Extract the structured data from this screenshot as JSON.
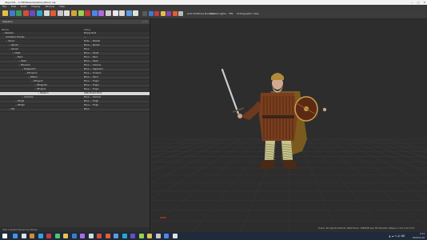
{
  "window": {
    "title": "Object32 - C:\\HE\\Objects\\Gallery\\Monk.obj",
    "controls": [
      "—",
      "□",
      "✕"
    ]
  },
  "menu": [
    "File",
    "Edit",
    "Build",
    "Display",
    "Window",
    "Help"
  ],
  "toolbar": {
    "render_labels": [
      "Auto Pick",
      "Show Normals",
      "Shaded",
      "Lights",
      "FPS",
      "Orthographic View"
    ],
    "icon_colors": [
      "#e3c04a",
      "#3d7cc9",
      "#3a9a5a",
      "#d64d3b",
      "#6a4cc2",
      "#2aa6c9",
      "#d9d9d9",
      "#e35e2f",
      "#c7c7c7",
      "#e0e0e0",
      "#d7a43a",
      "#9bd14c",
      "#c73b3b",
      "#4a86e8",
      "#b06be0",
      "#cfcfcf",
      "#e8e8e8",
      "#d9d9d9",
      "#5b9be0",
      "#e0e0e0"
    ],
    "viewport_icon_colors": [
      "#5a5a5a",
      "#3d7cc9",
      "#c73b3b",
      "#e3c04a",
      "#8e44ad",
      "#e35e2f",
      "#bbbbbb"
    ]
  },
  "panel": {
    "title": "Skeleton",
    "header_buttons": "□ ✕",
    "columns": {
      "name": "Name",
      "value": "Value"
    },
    "nodes": [
      {
        "name": "− Skeleton",
        "value": "Empty Root",
        "indent": 0
      },
      {
        "name": "Animation Frames",
        "value": "—",
        "indent": 1
      },
      {
        "name": "− ikCore",
        "value": "Node — Pelvis0",
        "indent": 1
      },
      {
        "name": "− Spine1",
        "value": "Bone — Spine1",
        "indent": 2
      },
      {
        "name": "− Spine2",
        "value": "Bone",
        "indent": 2
      },
      {
        "name": "− Chest",
        "value": "Bone — Chest",
        "indent": 3
      },
      {
        "name": "− Neck",
        "value": "Bone — Neck",
        "indent": 4
      },
      {
        "name": "− Head",
        "value": "Bone — Head",
        "indent": 5
      },
      {
        "name": "− RClavicle",
        "value": "Bone — Clavicle",
        "indent": 5
      },
      {
        "name": "− RUpperArm",
        "value": "Bone — UpperArm",
        "indent": 6
      },
      {
        "name": "− RForearm",
        "value": "Bone — Forearm",
        "indent": 7
      },
      {
        "name": "− RHand",
        "value": "Bone — Hand",
        "indent": 8
      },
      {
        "name": "− RFinger0",
        "value": "Bone — Finger",
        "indent": 9
      },
      {
        "name": "− RFinger01",
        "value": "Bone — Finger",
        "indent": 10
      },
      {
        "name": "− RFinger1",
        "value": "Bone — Finger",
        "indent": 10
      },
      {
        "name": "− Weapon",
        "value": "Attachment Point",
        "indent": 11,
        "selected": true
      },
      {
        "name": "− LClavicle",
        "value": "Bone — Clavicle",
        "indent": 6
      },
      {
        "name": "− LThigh",
        "value": "Bone — Thigh",
        "indent": 4
      },
      {
        "name": "− RThigh",
        "value": "Bone — Thigh",
        "indent": 4
      },
      {
        "name": "− Tail",
        "value": "Bone",
        "indent": 2
      }
    ],
    "status": "Skel Loaded      Hierarchy Ready"
  },
  "viewport": {
    "status_text": "Scene: 20 objects   Vertices: 8424   Faces: 10268   Bones: 80   Selected: Weapon   x:0.0 y:0.0 z:0.0"
  },
  "taskbar": {
    "icon_colors": [
      "#4a90e2",
      "#e0e0e0",
      "#d98b2b",
      "#3aa0d9",
      "#c73b3b",
      "#4ac96a",
      "#e8c24a",
      "#3d7cc9",
      "#b06be0",
      "#d9d9d9",
      "#d64d3b",
      "#e35e2f",
      "#5b9be0",
      "#2aa6c9",
      "#6a4cc2",
      "#9bd14c",
      "#e3c04a",
      "#c7c7c7",
      "#4a86e8",
      "#e0e0e0"
    ],
    "tray_icons": "▲ ☁ ✉ 🔊 ⌨",
    "time": "0:13",
    "date": "2020-04-16"
  }
}
